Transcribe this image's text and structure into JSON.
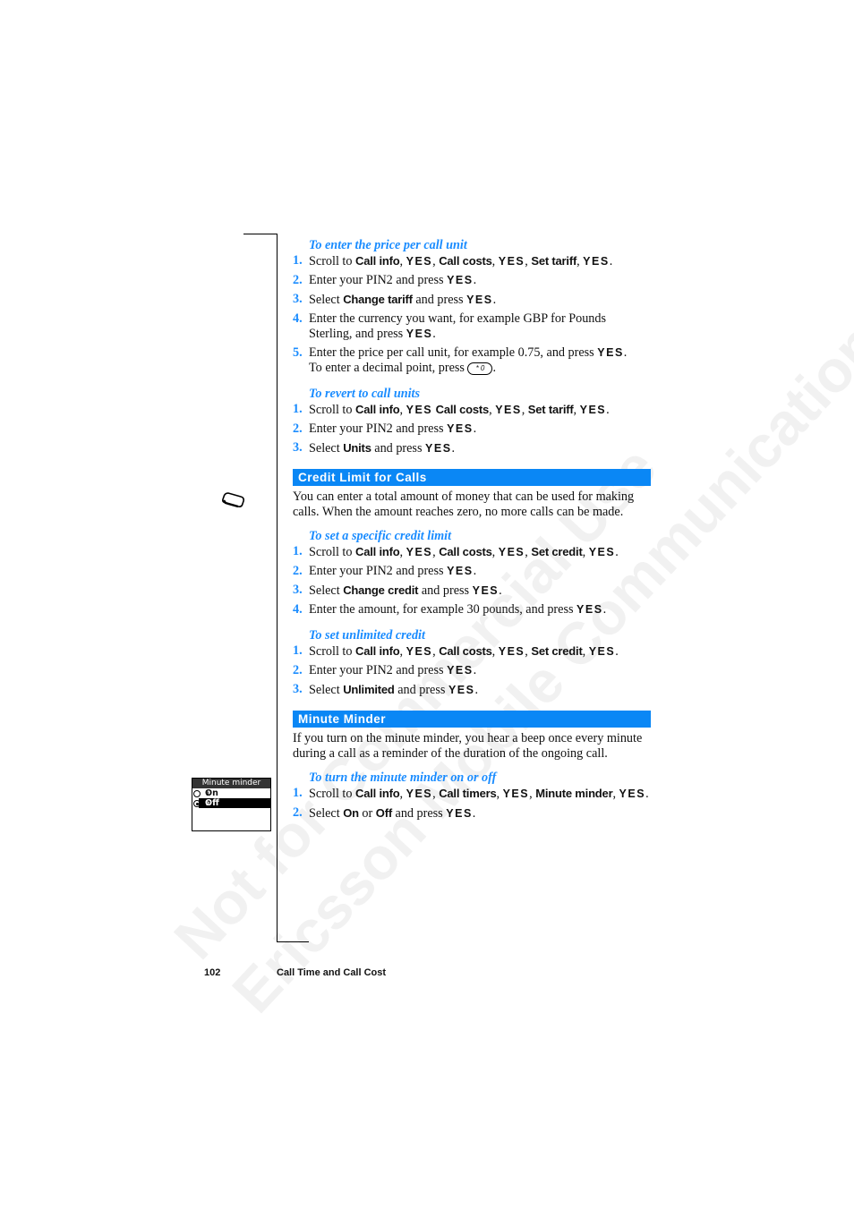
{
  "watermark": {
    "line1": "Not for Commercial Use",
    "line2": "Ericsson Mobile Communications AB"
  },
  "sections": {
    "tariff_price": {
      "heading": "To enter the price per call unit",
      "steps": [
        {
          "n": "1.",
          "parts": [
            "Scroll to ",
            "Call info",
            ", ",
            "YES",
            ", ",
            "Call costs",
            ", ",
            "YES",
            ", ",
            "Set tariff",
            ", ",
            "YES",
            "."
          ]
        },
        {
          "n": "2.",
          "parts": [
            "Enter your PIN2 and press ",
            "YES",
            "."
          ]
        },
        {
          "n": "3.",
          "parts": [
            "Select ",
            "Change tariff",
            " and press ",
            "YES",
            "."
          ]
        },
        {
          "n": "4.",
          "parts": [
            "Enter the currency you want, for example GBP for Pounds Sterling, and press ",
            "YES",
            "."
          ]
        },
        {
          "n": "5.",
          "parts": [
            "Enter the price per call unit, for example 0.75, and press ",
            "YES",
            ".",
            "To enter a decimal point, press ",
            "* 0",
            "."
          ]
        }
      ]
    },
    "revert_units": {
      "heading": "To revert to call units",
      "steps": [
        {
          "n": "1.",
          "parts": [
            "Scroll to ",
            "Call info",
            ", ",
            "YES",
            " ",
            "Call costs",
            ", ",
            "YES",
            ", ",
            "Set tariff",
            ", ",
            "YES",
            "."
          ]
        },
        {
          "n": "2.",
          "parts": [
            "Enter your PIN2 and press ",
            "YES",
            "."
          ]
        },
        {
          "n": "3.",
          "parts": [
            "Select ",
            "Units",
            " and press ",
            "YES",
            "."
          ]
        }
      ]
    },
    "credit_limit": {
      "title": "Credit Limit for Calls",
      "intro": "You can enter a total amount of money that can be used for making calls. When the amount reaches zero, no more calls can be made.",
      "specific": {
        "heading": "To set a specific credit limit",
        "steps": [
          {
            "n": "1.",
            "parts": [
              "Scroll to ",
              "Call info",
              ", ",
              "YES",
              ", ",
              "Call costs",
              ", ",
              "YES",
              ", ",
              "Set credit",
              ", ",
              "YES",
              "."
            ]
          },
          {
            "n": "2.",
            "parts": [
              "Enter your PIN2 and press ",
              "YES",
              "."
            ]
          },
          {
            "n": "3.",
            "parts": [
              "Select ",
              "Change credit",
              " and press ",
              "YES",
              "."
            ]
          },
          {
            "n": "4.",
            "parts": [
              "Enter the amount, for example 30 pounds, and press ",
              "YES",
              "."
            ]
          }
        ]
      },
      "unlimited": {
        "heading": "To set unlimited credit",
        "steps": [
          {
            "n": "1.",
            "parts": [
              "Scroll to ",
              "Call info",
              ", ",
              "YES",
              ", ",
              "Call costs",
              ", ",
              "YES",
              ", ",
              "Set credit",
              ", ",
              "YES",
              "."
            ]
          },
          {
            "n": "2.",
            "parts": [
              "Enter your PIN2 and press ",
              "YES",
              "."
            ]
          },
          {
            "n": "3.",
            "parts": [
              "Select ",
              "Unlimited",
              " and press ",
              "YES",
              "."
            ]
          }
        ]
      }
    },
    "minute_minder": {
      "title": "Minute Minder",
      "intro": "If you turn on the minute minder, you hear a beep once every minute during a call as a reminder of the duration of the ongoing call.",
      "toggle": {
        "heading": "To turn the minute minder on or off",
        "steps": [
          {
            "n": "1.",
            "parts": [
              "Scroll to ",
              "Call info",
              ", ",
              "YES",
              ", ",
              "Call timers",
              ", ",
              "YES",
              ", ",
              "Minute minder",
              ", ",
              "YES",
              "."
            ]
          },
          {
            "n": "2.",
            "parts": [
              "Select ",
              "On",
              " or ",
              "Off",
              " and press ",
              "YES",
              "."
            ]
          }
        ]
      }
    }
  },
  "phone_screen": {
    "title": "Minute minder",
    "options": [
      {
        "index": "1",
        "label": "On",
        "selected": false
      },
      {
        "index": "2",
        "label": "Off",
        "selected": true
      }
    ]
  },
  "icons": {
    "margin_icon": "phone-key-icon",
    "decimal_key": "star-zero-key-icon"
  },
  "colors": {
    "accent": "#1a8cff",
    "section_bar": "#0a87f5"
  },
  "footer": {
    "page_number": "102",
    "chapter_title": "Call Time and Call Cost"
  }
}
